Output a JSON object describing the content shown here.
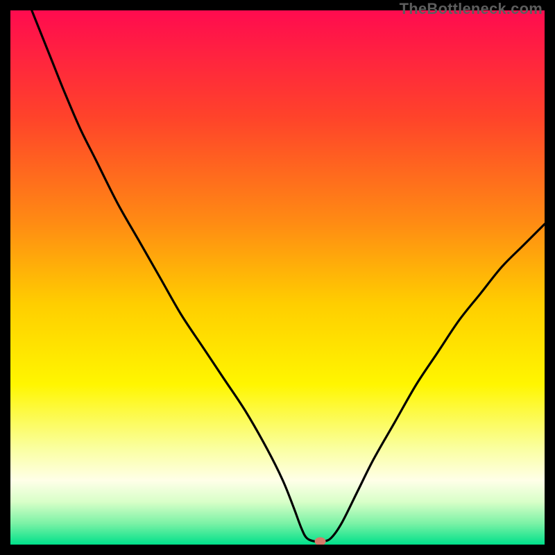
{
  "watermark": "TheBottleneck.com",
  "colors": {
    "black": "#000000",
    "curve": "#000000",
    "marker": "#d47b6a"
  },
  "chart_data": {
    "type": "line",
    "title": "",
    "xlabel": "",
    "ylabel": "",
    "xlim": [
      0,
      100
    ],
    "ylim": [
      0,
      100
    ],
    "gradient_stops": [
      {
        "offset": 0.0,
        "color": "#ff0b4f"
      },
      {
        "offset": 0.2,
        "color": "#ff432a"
      },
      {
        "offset": 0.4,
        "color": "#ff8c13"
      },
      {
        "offset": 0.55,
        "color": "#ffce00"
      },
      {
        "offset": 0.7,
        "color": "#fff600"
      },
      {
        "offset": 0.82,
        "color": "#faffa0"
      },
      {
        "offset": 0.88,
        "color": "#ffffe8"
      },
      {
        "offset": 0.92,
        "color": "#d8ffc8"
      },
      {
        "offset": 0.96,
        "color": "#7cf2a6"
      },
      {
        "offset": 1.0,
        "color": "#00e08a"
      }
    ],
    "series": [
      {
        "name": "bottleneck-curve",
        "x": [
          4,
          6,
          8,
          10,
          13,
          16,
          20,
          24,
          28,
          32,
          36,
          40,
          44,
          48,
          51,
          53,
          54.5,
          55.5,
          57,
          58.5,
          60,
          62,
          65,
          68,
          72,
          76,
          80,
          84,
          88,
          92,
          96,
          100
        ],
        "y": [
          100,
          95,
          90,
          85,
          78,
          72,
          64,
          57,
          50,
          43,
          37,
          31,
          25,
          18,
          12,
          7,
          3,
          1.2,
          0.6,
          0.6,
          1.2,
          4,
          10,
          16,
          23,
          30,
          36,
          42,
          47,
          52,
          56,
          60
        ]
      }
    ],
    "marker": {
      "x": 58,
      "y": 0.6
    }
  }
}
